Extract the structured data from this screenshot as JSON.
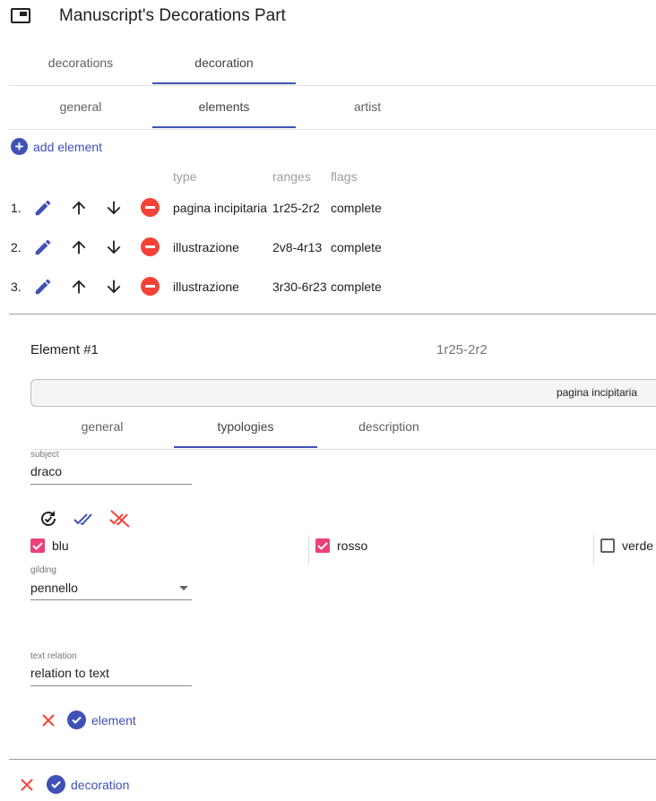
{
  "header": {
    "title": "Manuscript's Decorations Part",
    "icon": "web-asset-icon"
  },
  "main_tabs": [
    {
      "label": "decorations",
      "active": false
    },
    {
      "label": "decoration",
      "active": true
    }
  ],
  "sub_tabs": [
    {
      "label": "general",
      "active": false
    },
    {
      "label": "elements",
      "active": true
    },
    {
      "label": "artist",
      "active": false
    }
  ],
  "add_element_label": "add element",
  "columns": {
    "type": "type",
    "ranges": "ranges",
    "flags": "flags"
  },
  "elements": [
    {
      "num": "1.",
      "type": "pagina incipitaria",
      "ranges": "1r25-2r2",
      "flags": "complete"
    },
    {
      "num": "2.",
      "type": "illustrazione",
      "ranges": "2v8-4r13",
      "flags": "complete"
    },
    {
      "num": "3.",
      "type": "illustrazione",
      "ranges": "3r30-6r23",
      "flags": "complete"
    }
  ],
  "element_editor": {
    "title": "Element #1",
    "range": "1r25-2r2",
    "chip": "pagina incipitaria",
    "tabs": [
      {
        "label": "general",
        "active": false
      },
      {
        "label": "typologies",
        "active": true
      },
      {
        "label": "description",
        "active": false
      }
    ],
    "subject": {
      "label": "subject",
      "value": "draco"
    },
    "colors": [
      {
        "label": "blu",
        "checked": true
      },
      {
        "label": "rosso",
        "checked": true
      },
      {
        "label": "verde",
        "checked": false
      }
    ],
    "gilding": {
      "label": "gilding",
      "value": "pennello"
    },
    "text_relation": {
      "label": "text relation",
      "value": "relation to text"
    },
    "save_label": "element"
  },
  "footer": {
    "save_label": "decoration"
  },
  "colors": {
    "primary": "#3f51b5",
    "warn": "#f44336",
    "accent": "#ec407a"
  }
}
